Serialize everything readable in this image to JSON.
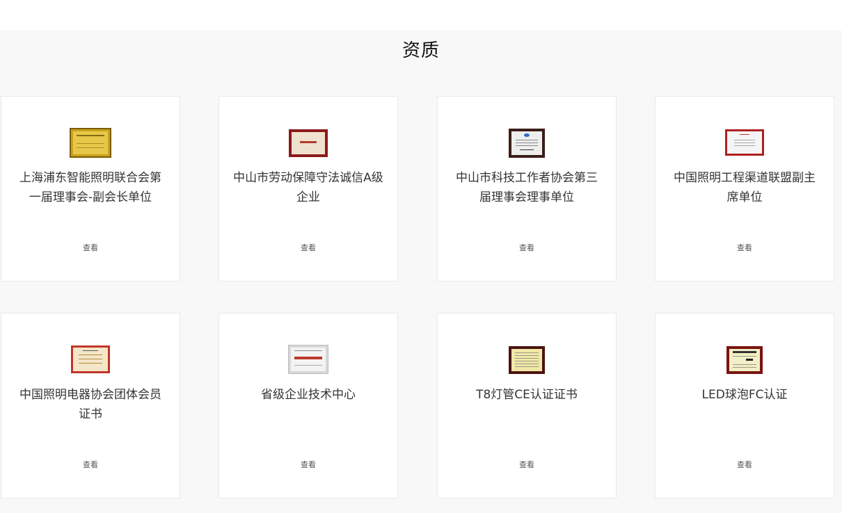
{
  "section": {
    "title": "资质"
  },
  "view_label": "查看",
  "cards": [
    {
      "title": "上海浦东智能照明联合会第一届理事会-副会长单位",
      "view": "查看",
      "icon": "gold-certificate-icon"
    },
    {
      "title": "中山市劳动保障守法诚信A级企业",
      "view": "查看",
      "icon": "framed-certificate-icon"
    },
    {
      "title": "中山市科技工作者协会第三届理事会理事单位",
      "view": "查看",
      "icon": "framed-certificate-icon"
    },
    {
      "title": "中国照明工程渠道联盟副主席单位",
      "view": "查看",
      "icon": "certificate-icon"
    },
    {
      "title": "中国照明电器协会团体会员证书",
      "view": "查看",
      "icon": "certificate-icon"
    },
    {
      "title": "省级企业技术中心",
      "view": "查看",
      "icon": "plaque-icon"
    },
    {
      "title": "T8灯管CE认证证书",
      "view": "查看",
      "icon": "certificate-icon"
    },
    {
      "title": "LED球泡FC认证",
      "view": "查看",
      "icon": "certificate-icon"
    }
  ]
}
